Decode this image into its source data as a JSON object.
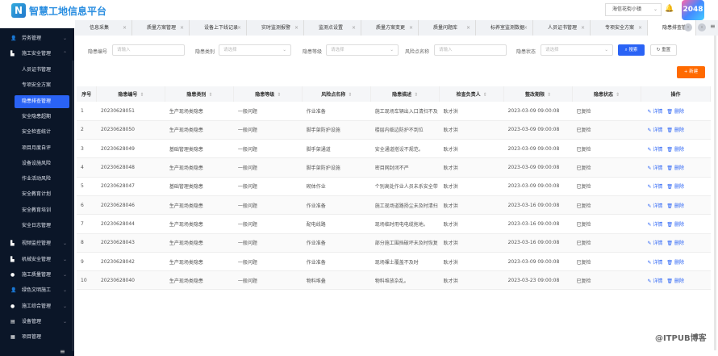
{
  "header": {
    "logo_text": "N",
    "title": "智慧工地信息平台",
    "project": "海信花街小镇",
    "badge": "2048"
  },
  "sidebar": {
    "groups": [
      {
        "label": "劳务管理",
        "icon": "person-icon"
      },
      {
        "label": "施工安全管理",
        "icon": "document-icon"
      }
    ],
    "sub": [
      "人员证书管理",
      "专项安全方案",
      "隐患排查管理",
      "安全隐患超期",
      "安全检查统计",
      "项目月度自评",
      "设备设施风险",
      "作业活动风险",
      "安全教育计划",
      "安全教育培训",
      "安全日志管理"
    ],
    "groups2": [
      {
        "label": "视频监控管理",
        "icon": "document-icon"
      },
      {
        "label": "机械安全管理",
        "icon": "document-icon"
      },
      {
        "label": "施工质量管理",
        "icon": "gauge-icon"
      },
      {
        "label": "绿色文明施工",
        "icon": "person-icon"
      },
      {
        "label": "施工综合管理",
        "icon": "gauge-icon"
      },
      {
        "label": "设备管理",
        "icon": "device-icon"
      },
      {
        "label": "项目管理",
        "icon": "project-icon"
      }
    ]
  },
  "tabs": [
    "信息采集",
    "质量方案管理",
    "设备上下线记录",
    "实时监测报警",
    "监测点设置",
    "质量方案变更",
    "质量问题库",
    "标养室监测数据",
    "人员证书管理",
    "专项安全方案",
    "隐患排查管理"
  ],
  "filters": [
    {
      "label": "隐患编号",
      "placeholder": "请输入"
    },
    {
      "label": "隐患类别",
      "placeholder": "请选择"
    },
    {
      "label": "隐患等级",
      "placeholder": "请选择"
    },
    {
      "label": "风险点名称",
      "placeholder": "请输入"
    },
    {
      "label": "隐患状态",
      "placeholder": "请选择"
    }
  ],
  "buttons": {
    "search": "搜索",
    "reset": "重置",
    "new": "+ 新建"
  },
  "table": {
    "headers": [
      "序号",
      "隐患编号",
      "隐患类别",
      "隐患等级",
      "风险点名称",
      "隐患描述",
      "检查负责人",
      "整改期限",
      "隐患状态",
      "操作"
    ],
    "actions": {
      "detail": "详情",
      "delete": "删除"
    },
    "rows": [
      [
        "1",
        "20230628051",
        "生产现场类隐患",
        "一般问题",
        "作业准备",
        "施工现场车辆出入口清扫不及",
        "耿才洪",
        "2023-03-09 09:00:08",
        "已复检"
      ],
      [
        "2",
        "20230628050",
        "生产现场类隐患",
        "一般问题",
        "脚手架防护设施",
        "楼层内临边防护不到位",
        "耿才洪",
        "2023-03-09 09:00:08",
        "已复检"
      ],
      [
        "3",
        "20230628049",
        "基础管理类隐患",
        "一般问题",
        "脚手架通道",
        "安全通道搭设不规范。",
        "耿才洪",
        "2023-03-09 09:00:08",
        "已复检"
      ],
      [
        "4",
        "20230628048",
        "生产现场类隐患",
        "一般问题",
        "脚手架防护设施",
        "密目网封闭不严",
        "耿才洪",
        "2023-03-09 09:00:08",
        "已复检"
      ],
      [
        "5",
        "20230628047",
        "基础管理类隐患",
        "一般问题",
        "砌体作业",
        "个别高处作业人员未系安全带",
        "耿才洪",
        "2023-03-09 09:00:08",
        "已复检"
      ],
      [
        "6",
        "20230628046",
        "生产现场类隐患",
        "一般问题",
        "作业准备",
        "施工现场道路扬尘未及时清扫",
        "耿才洪",
        "2023-03-16 09:00:08",
        "已复检"
      ],
      [
        "7",
        "20230628044",
        "生产现场类隐患",
        "一般问题",
        "配电线路",
        "现场临时用电电缆拖地。",
        "耿才洪",
        "2023-03-16 09:00:08",
        "已复检"
      ],
      [
        "8",
        "20230628043",
        "生产现场类隐患",
        "一般问题",
        "作业准备",
        "部分施工围挡破坏未及时恢复",
        "耿才洪",
        "2023-03-16 09:00:08",
        "已复检"
      ],
      [
        "9",
        "20230628042",
        "生产现场类隐患",
        "一般问题",
        "作业准备",
        "现场裸土覆盖不及时",
        "耿才洪",
        "2023-03-09 09:00:08",
        "已复检"
      ],
      [
        "10",
        "20230628040",
        "生产现场类隐患",
        "一般问题",
        "物料堆叠",
        "物料堆放杂乱。",
        "耿才洪",
        "2023-03-23 09:00:08",
        "已复检"
      ]
    ]
  },
  "watermark": "@ITPUB博客"
}
